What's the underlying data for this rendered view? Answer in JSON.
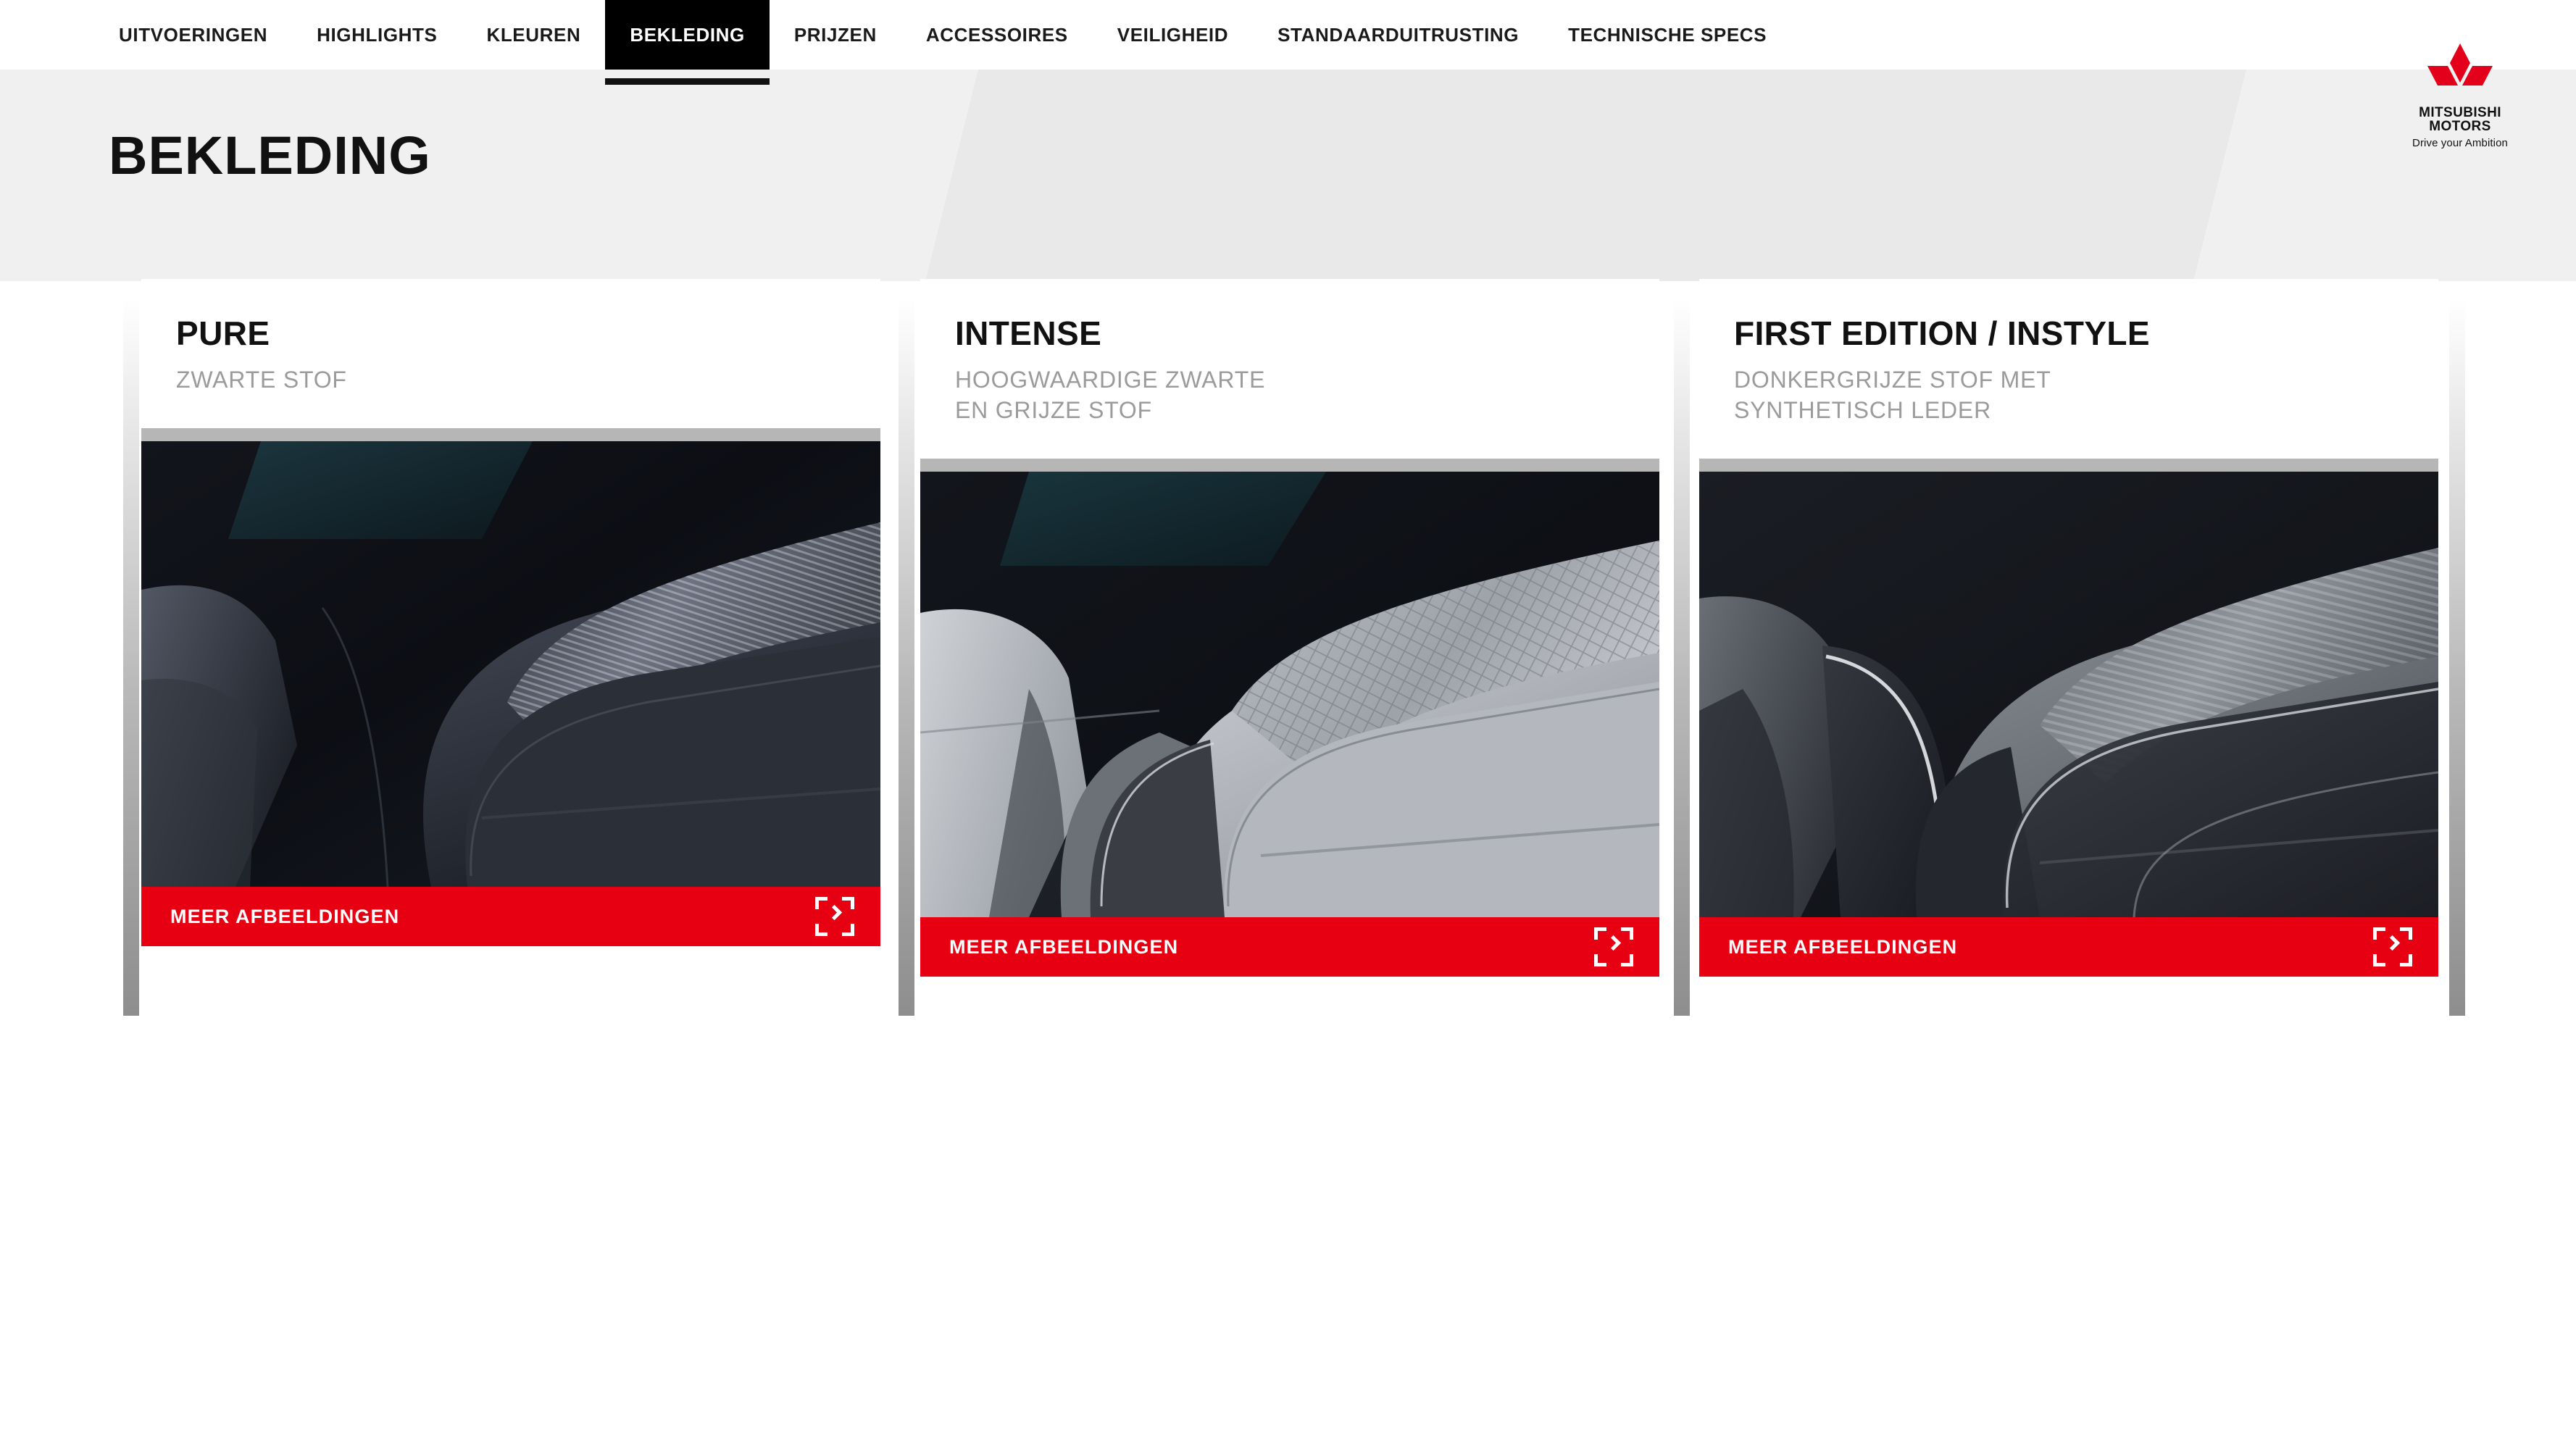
{
  "nav": {
    "items": [
      {
        "label": "UITVOERINGEN",
        "active": false
      },
      {
        "label": "HIGHLIGHTS",
        "active": false
      },
      {
        "label": "KLEUREN",
        "active": false
      },
      {
        "label": "BEKLEDING",
        "active": true
      },
      {
        "label": "PRIJZEN",
        "active": false
      },
      {
        "label": "ACCESSOIRES",
        "active": false
      },
      {
        "label": "VEILIGHEID",
        "active": false
      },
      {
        "label": "STANDAARDUITRUSTING",
        "active": false
      },
      {
        "label": "TECHNISCHE SPECS",
        "active": false
      }
    ]
  },
  "hero": {
    "title": "BEKLEDING"
  },
  "brand": {
    "name_line1": "MITSUBISHI",
    "name_line2": "MOTORS",
    "tagline": "Drive your Ambition",
    "mark_color": "#e2001a"
  },
  "colors": {
    "accent_red": "#e60012",
    "hero_bg": "#f0f0f0",
    "subtitle_gray": "#9b9b9b",
    "accent_bar_gray": "#8e8e8e",
    "image_strip_gray": "#b6b6b6"
  },
  "cards": [
    {
      "title": "PURE",
      "subtitle_lines": [
        "ZWARTE STOF"
      ],
      "cta_label": "MEER AFBEELDINGEN",
      "cta_icon": "expand-arrow-icon",
      "photo_alt": "Zwarte stoffen autostoel close-up"
    },
    {
      "title": "INTENSE",
      "subtitle_lines": [
        "HOOGWAARDIGE ZWARTE",
        "EN GRIJZE STOF"
      ],
      "cta_label": "MEER AFBEELDINGEN",
      "cta_icon": "expand-arrow-icon",
      "photo_alt": "Grijze gewatteerde stoffen autostoel close-up"
    },
    {
      "title": "FIRST EDITION / INSTYLE",
      "subtitle_lines": [
        "DONKERGRIJZE STOF MET",
        "SYNTHETISCH LEDER"
      ],
      "cta_label": "MEER AFBEELDINGEN",
      "cta_icon": "expand-arrow-icon",
      "photo_alt": "Donkergrijze stof met synthetisch leder autostoel close-up"
    }
  ]
}
